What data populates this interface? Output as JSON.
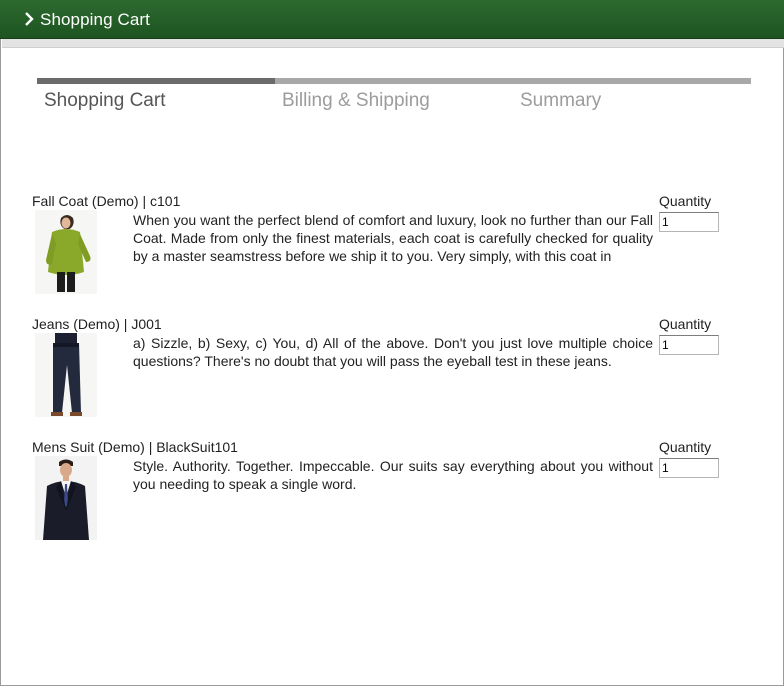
{
  "header": {
    "title": "Shopping Cart"
  },
  "steps": {
    "step1": "Shopping Cart",
    "step2": "Billing & Shipping",
    "step3": "Summary",
    "completed_fraction": 0.333
  },
  "items": [
    {
      "name": "Fall Coat (Demo) | c101",
      "quantity_label": "Quantity",
      "quantity": "1",
      "description": "When you want the perfect blend of comfort and luxury, look no further than our Fall Coat. Made from only the finest materials, each coat is carefully checked for quality by a master seamstress before we ship it to you. Very simply, with this coat in"
    },
    {
      "name": "Jeans (Demo) | J001",
      "quantity_label": "Quantity",
      "quantity": "1",
      "description": "a) Sizzle, b) Sexy, c) You, d) All of the above. Don't you just love multiple choice questions? There's no doubt that you will pass the eyeball test in these jeans."
    },
    {
      "name": "Mens Suit (Demo) | BlackSuit101",
      "quantity_label": "Quantity",
      "quantity": "1",
      "description": "Style. Authority. Together. Impeccable. Our suits say everything about you without you needing to speak a single word."
    }
  ],
  "colors": {
    "header_green": "#1e5421",
    "progress_done": "#6b6b6b",
    "progress_todo": "#a8a8a8"
  }
}
